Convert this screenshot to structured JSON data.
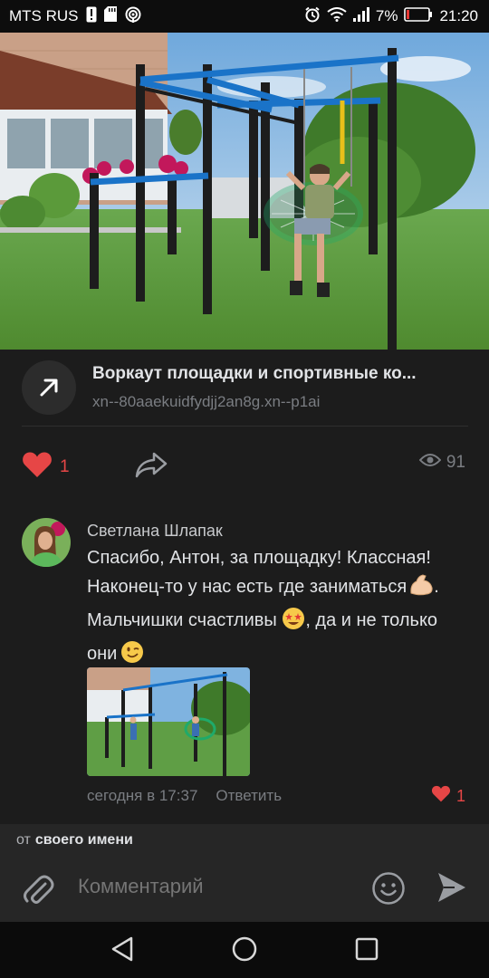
{
  "status_bar": {
    "carrier": "MTS RUS",
    "battery": "7%",
    "time": "21:20"
  },
  "link": {
    "title": "Воркаут площадки и спортивные ко...",
    "url": "xn--80aaekuidfydjj2an8g.xn--p1ai"
  },
  "post_actions": {
    "like_count": "1",
    "views_count": "91"
  },
  "comment": {
    "author": "Светлана Шлапак",
    "text_part1": "Спасибо, Антон, за площадку! Классная! Наконец-то у нас есть где заниматься",
    "text_part2": ". Мальчишки счастливы ",
    "text_part3": ", да и не только они",
    "emojis": [
      "flexed-biceps",
      "star-struck",
      "winking-face"
    ],
    "time": "сегодня в 17:37",
    "reply_label": "Ответить",
    "like_count": "1"
  },
  "from": {
    "prefix": "от",
    "name": "своего имени"
  },
  "composer": {
    "placeholder": "Комментарий"
  },
  "colors": {
    "like_red": "#e64646",
    "background": "#1c1c1c",
    "muted": "#7a7d82"
  },
  "icons": [
    "sim-alert-icon",
    "sd-card-icon",
    "hotspot-icon",
    "alarm-icon",
    "wifi-icon",
    "signal-icon",
    "battery-icon",
    "arrow-link-icon",
    "heart-icon",
    "share-icon",
    "eye-icon",
    "paperclip-icon",
    "smiley-icon",
    "send-icon",
    "back-icon",
    "home-icon",
    "recent-apps-icon"
  ]
}
